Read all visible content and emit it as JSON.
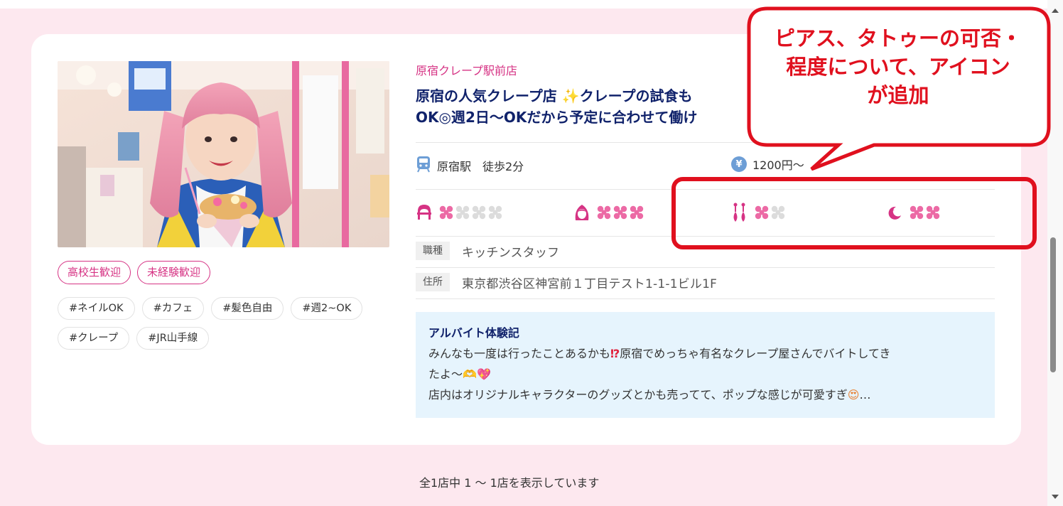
{
  "listing": {
    "store_name": "原宿クレープ駅前店",
    "headline_part1": "原宿の人気クレープ店",
    "headline_part2": "クレープの試食も",
    "headline_part3": "OK",
    "headline_part4": "週2日〜OKだから予定に合わせて働け",
    "access": {
      "station": "原宿駅　徒歩2分",
      "wage": "1200円〜"
    },
    "badges": [
      "高校生歓迎",
      "未経験歓迎"
    ],
    "tags": [
      "#ネイルOK",
      "#カフェ",
      "#髪色自由",
      "#週2~OK",
      "#クレープ",
      "#JR山手線"
    ],
    "job_type": {
      "label": "職種",
      "value": "キッチンスタッフ"
    },
    "address": {
      "label": "住所",
      "value": "東京都渋谷区神宮前１丁目テスト1-1-1ビル1F"
    },
    "diary": {
      "title": "アルバイト体験記",
      "line1": "みんなも一度は行ったことあるかも",
      "line1b": "原宿でめっちゃ有名なクレープ屋さんでバイトしてき",
      "line2": "たよ〜",
      "line3": "店内はオリジナルキャラクターのグッズとかも売ってて、ポップな感じが可愛すぎ",
      "line3_end": "…"
    },
    "icon_ratings": [
      {
        "icon": "hat-icon",
        "active": 1,
        "total": 4
      },
      {
        "icon": "hair-color-icon",
        "active": 3,
        "total": 3
      },
      {
        "icon": "piercing-icon",
        "active": 1,
        "total": 2
      },
      {
        "icon": "moon-icon",
        "active": 2,
        "total": 2
      }
    ]
  },
  "footer": {
    "result_text": "全1店中 1 〜 1店を表示しています"
  },
  "annotation": {
    "callout_text": "ピアス、タトゥーの可否・\n程度について、アイコン\nが追加"
  },
  "colors": {
    "accent_pink": "#d63384",
    "navy": "#10226b",
    "callout_red": "#e0101e",
    "page_bg": "#fde8ef"
  }
}
